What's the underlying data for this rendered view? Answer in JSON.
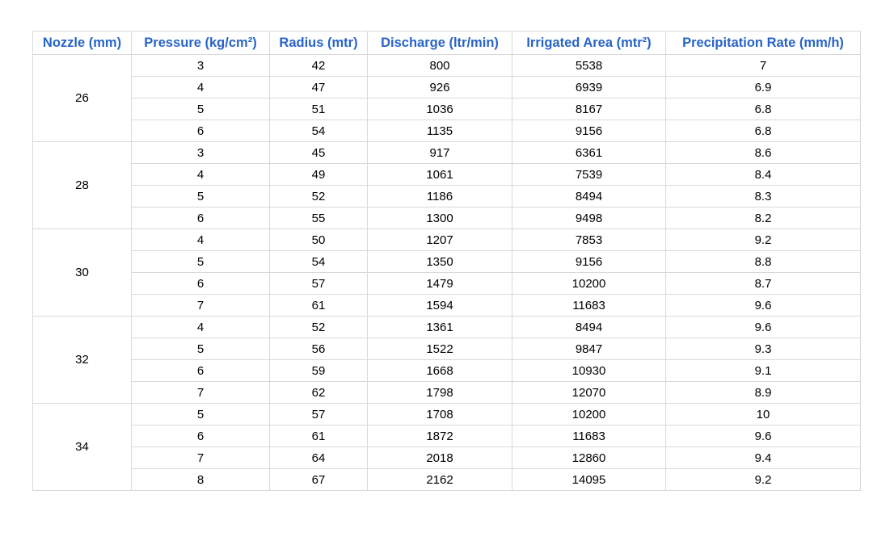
{
  "table": {
    "headers": [
      "Nozzle (mm)",
      "Pressure (kg/cm²)",
      "Radius (mtr)",
      "Discharge (ltr/min)",
      "Irrigated Area (mtr²)",
      "Precipitation Rate (mm/h)"
    ],
    "header_color": "#2864c8",
    "groups": [
      {
        "nozzle": "26",
        "rows": [
          [
            "3",
            "42",
            "800",
            "5538",
            "7"
          ],
          [
            "4",
            "47",
            "926",
            "6939",
            "6.9"
          ],
          [
            "5",
            "51",
            "1036",
            "8167",
            "6.8"
          ],
          [
            "6",
            "54",
            "1135",
            "9156",
            "6.8"
          ]
        ]
      },
      {
        "nozzle": "28",
        "rows": [
          [
            "3",
            "45",
            "917",
            "6361",
            "8.6"
          ],
          [
            "4",
            "49",
            "1061",
            "7539",
            "8.4"
          ],
          [
            "5",
            "52",
            "1186",
            "8494",
            "8.3"
          ],
          [
            "6",
            "55",
            "1300",
            "9498",
            "8.2"
          ]
        ]
      },
      {
        "nozzle": "30",
        "rows": [
          [
            "4",
            "50",
            "1207",
            "7853",
            "9.2"
          ],
          [
            "5",
            "54",
            "1350",
            "9156",
            "8.8"
          ],
          [
            "6",
            "57",
            "1479",
            "10200",
            "8.7"
          ],
          [
            "7",
            "61",
            "1594",
            "11683",
            "9.6"
          ]
        ]
      },
      {
        "nozzle": "32",
        "rows": [
          [
            "4",
            "52",
            "1361",
            "8494",
            "9.6"
          ],
          [
            "5",
            "56",
            "1522",
            "9847",
            "9.3"
          ],
          [
            "6",
            "59",
            "1668",
            "10930",
            "9.1"
          ],
          [
            "7",
            "62",
            "1798",
            "12070",
            "8.9"
          ]
        ]
      },
      {
        "nozzle": "34",
        "rows": [
          [
            "5",
            "57",
            "1708",
            "10200",
            "10"
          ],
          [
            "6",
            "61",
            "1872",
            "11683",
            "9.6"
          ],
          [
            "7",
            "64",
            "2018",
            "12860",
            "9.4"
          ],
          [
            "8",
            "67",
            "2162",
            "14095",
            "9.2"
          ]
        ]
      }
    ]
  }
}
